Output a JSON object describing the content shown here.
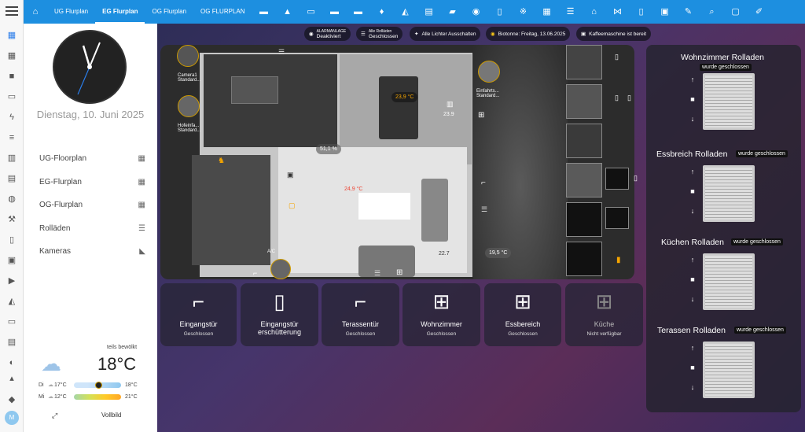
{
  "topbar": {
    "tabs": [
      "UG Flurplan",
      "EG Flurplan",
      "OG Flurplan",
      "OG FLURPLAN"
    ],
    "active": "EG Flurplan",
    "color": "#1d8fe0"
  },
  "clock": {
    "date": "Dienstag, 10. Juni 2025"
  },
  "nav": [
    {
      "label": "UG-Floorplan"
    },
    {
      "label": "EG-Flurplan"
    },
    {
      "label": "OG-Flurplan"
    },
    {
      "label": "Rolläden"
    },
    {
      "label": "Kameras"
    }
  ],
  "weather": {
    "condition": "teils bewölkt",
    "temperature": "18°C",
    "forecast": [
      {
        "day": "Di",
        "low": "17°C",
        "high": "18°C"
      },
      {
        "day": "Mi",
        "low": "12°C",
        "high": "21°C"
      }
    ]
  },
  "footer": {
    "fullscreen": "Vollbild"
  },
  "user": {
    "initial": "M"
  },
  "status": [
    {
      "label": "ALARMANLAGE",
      "value": "Deaktiviert"
    },
    {
      "label": "Alle Rolläden",
      "value": "Geschlossen"
    },
    {
      "label": "",
      "value": "Alle Lichter Ausschalten"
    },
    {
      "label": "",
      "value": "Biotonne: Freitag, 13.06.2025"
    },
    {
      "label": "",
      "value": "Kaffeemaschine ist bereit"
    }
  ],
  "floorplan": {
    "cam1": "Camera1 Standard...",
    "cam2": "Hofeinfa... Standard...",
    "cam3": "Einfahrts... Standard...",
    "temp1": "23,9 °C",
    "temp2": "23.9",
    "humidity": "51,1 %",
    "temp3": "24,9 °C",
    "temp4": "22.7",
    "temp5": "19,5 °C",
    "ac": "A/C"
  },
  "tiles": [
    {
      "name": "Eingangstür",
      "state": "Geschlossen"
    },
    {
      "name": "Eingangstür erschütterung",
      "state": ""
    },
    {
      "name": "Terassentür",
      "state": "Geschlossen"
    },
    {
      "name": "Wohnzimmer",
      "state": "Geschlossen"
    },
    {
      "name": "Essbereich",
      "state": "Geschlossen"
    },
    {
      "name": "Küche",
      "state": "Nicht verfügbar"
    }
  ],
  "rolladen": [
    {
      "title": "Wohnzimmer Rolladen",
      "status": "wurde geschlossen"
    },
    {
      "title": "Essbreich Rolladen",
      "status": "wurde geschlossen"
    },
    {
      "title": "Küchen Rolladen",
      "status": "wurde geschlossen"
    },
    {
      "title": "Terassen Rolladen",
      "status": "wurde geschlossen"
    }
  ]
}
